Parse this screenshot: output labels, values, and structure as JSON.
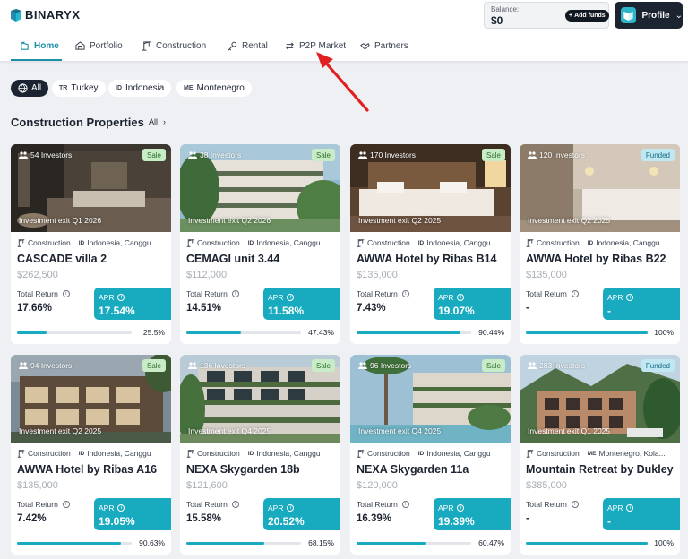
{
  "brand": {
    "name": "BINARYX"
  },
  "header": {
    "balance_label": "Balance:",
    "balance_value": "$0",
    "add_funds_label": "Add funds",
    "profile_label": "Profile"
  },
  "nav": {
    "items": [
      {
        "label": "Home",
        "icon": "home-icon",
        "active": true
      },
      {
        "label": "Portfolio",
        "icon": "portfolio-icon"
      },
      {
        "label": "Construction",
        "icon": "crane-icon"
      },
      {
        "label": "Rental",
        "icon": "key-icon"
      },
      {
        "label": "P2P Market",
        "icon": "swap-icon"
      },
      {
        "label": "Partners",
        "icon": "handshake-icon"
      }
    ]
  },
  "filters": {
    "items": [
      {
        "label": "All",
        "code": "",
        "active": true
      },
      {
        "label": "Turkey",
        "code": "TR"
      },
      {
        "label": "Indonesia",
        "code": "ID"
      },
      {
        "label": "Montenegro",
        "code": "ME"
      }
    ]
  },
  "section": {
    "title": "Construction Properties",
    "all_label": "All"
  },
  "common": {
    "total_return_label": "Total Return",
    "apr_label": "APR",
    "construction_label": "Construction"
  },
  "colors": {
    "accent": "#18aabf",
    "nav_active": "#1a8fa6",
    "sale_badge": "#c8ecc6",
    "funded_badge": "#bfe8f2"
  },
  "cards": [
    {
      "investors": "54 Investors",
      "badge": "Sale",
      "exit": "Investment exit Q1 2026",
      "country_code": "ID",
      "location": "Indonesia, Canggu",
      "title": "CASCADE villa 2",
      "price": "$262,500",
      "total_return": "17.66%",
      "apr": "17.54%",
      "progress_label": "25.5%",
      "progress": 25.5
    },
    {
      "investors": "38 Investors",
      "badge": "Sale",
      "exit": "Investment exit Q2 2026",
      "country_code": "ID",
      "location": "Indonesia, Canggu",
      "title": "CEMAGI unit 3.44",
      "price": "$112,000",
      "total_return": "14.51%",
      "apr": "11.58%",
      "progress_label": "47.43%",
      "progress": 47.43
    },
    {
      "investors": "170 Investors",
      "badge": "Sale",
      "exit": "Investment exit Q2 2025",
      "country_code": "ID",
      "location": "Indonesia, Canggu",
      "title": "AWWA Hotel by Ribas B14",
      "price": "$135,000",
      "total_return": "7.43%",
      "apr": "19.07%",
      "progress_label": "90.44%",
      "progress": 90.44
    },
    {
      "investors": "120 Investors",
      "badge": "Funded",
      "exit": "Investment exit Q2 2025",
      "country_code": "ID",
      "location": "Indonesia, Canggu",
      "title": "AWWA Hotel by Ribas B22",
      "price": "$135,000",
      "total_return": "-",
      "apr": "-",
      "progress_label": "100%",
      "progress": 100
    },
    {
      "investors": "94 Investors",
      "badge": "Sale",
      "exit": "Investment exit Q2 2025",
      "country_code": "ID",
      "location": "Indonesia, Canggu",
      "title": "AWWA Hotel by Ribas A16",
      "price": "$135,000",
      "total_return": "7.42%",
      "apr": "19.05%",
      "progress_label": "90.63%",
      "progress": 90.63
    },
    {
      "investors": "136 Investors",
      "badge": "Sale",
      "exit": "Investment exit Q4 2025",
      "country_code": "ID",
      "location": "Indonesia, Canggu",
      "title": "NEXA Skygarden 18b",
      "price": "$121,600",
      "total_return": "15.58%",
      "apr": "20.52%",
      "progress_label": "68.15%",
      "progress": 68.15
    },
    {
      "investors": "96 Investors",
      "badge": "Sale",
      "exit": "Investment exit Q4 2025",
      "country_code": "ID",
      "location": "Indonesia, Canggu",
      "title": "NEXA Skygarden 11a",
      "price": "$120,000",
      "total_return": "16.39%",
      "apr": "19.39%",
      "progress_label": "60.47%",
      "progress": 60.47
    },
    {
      "investors": "283 Investors",
      "badge": "Funded",
      "exit": "Investment exit Q1 2025",
      "country_code": "ME",
      "location": "Montenegro, Kola...",
      "title": "Mountain Retreat by Dukley",
      "price": "$385,000",
      "total_return": "-",
      "apr": "-",
      "progress_label": "100%",
      "progress": 100
    }
  ]
}
